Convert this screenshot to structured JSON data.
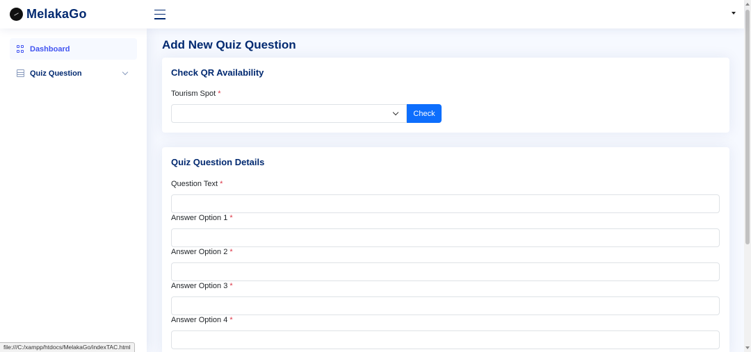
{
  "header": {
    "app_name": "MelakaGo"
  },
  "sidebar": {
    "items": [
      {
        "label": "Dashboard",
        "icon": "grid-icon",
        "active": true
      },
      {
        "label": "Quiz Question",
        "icon": "list-icon",
        "expandable": true
      }
    ]
  },
  "main": {
    "page_title": "Add New Quiz Question",
    "qr_card": {
      "title": "Check QR Availability",
      "tourism_spot_label": "Tourism Spot",
      "required_mark": "*",
      "tourism_spot_value": "",
      "check_button": "Check"
    },
    "details_card": {
      "title": "Quiz Question Details",
      "fields": [
        {
          "label": "Question Text",
          "value": ""
        },
        {
          "label": "Answer Option 1",
          "value": ""
        },
        {
          "label": "Answer Option 2",
          "value": ""
        },
        {
          "label": "Answer Option 3",
          "value": ""
        },
        {
          "label": "Answer Option 4",
          "value": ""
        }
      ],
      "required_mark": "*"
    }
  },
  "status_bar": {
    "url": "file:///C:/xampp/htdocs/MelakaGo/indexTAC.html"
  },
  "colors": {
    "brand": "#012970",
    "accent": "#0d6efd",
    "required": "#dc3545"
  }
}
